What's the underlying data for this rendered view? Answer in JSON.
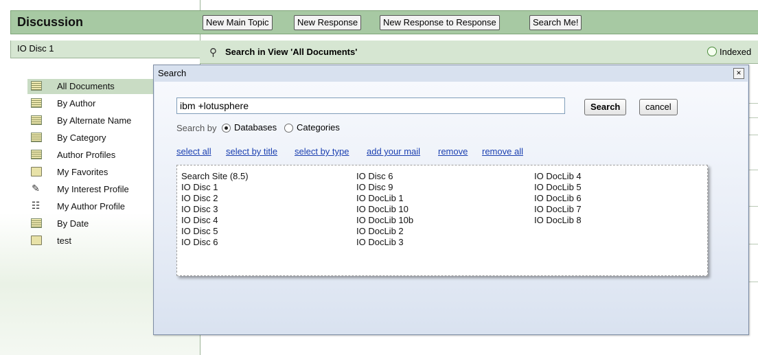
{
  "app": {
    "title": "Discussion",
    "db_name": "IO Disc 1"
  },
  "nav": {
    "items": [
      {
        "label": "All Documents",
        "icon": "view-icon",
        "selected": true
      },
      {
        "label": "By Author",
        "icon": "view-icon"
      },
      {
        "label": "By Alternate Name",
        "icon": "view-icon"
      },
      {
        "label": "By Category",
        "icon": "view-icon"
      },
      {
        "label": "Author Profiles",
        "icon": "view-icon"
      },
      {
        "label": "My Favorites",
        "icon": "folder-icon"
      },
      {
        "label": "My Interest Profile",
        "icon": "profile-icon"
      },
      {
        "label": "My Author Profile",
        "icon": "author-profile-icon"
      },
      {
        "label": "By Date",
        "icon": "view-icon"
      },
      {
        "label": "test",
        "icon": "folder-icon"
      }
    ]
  },
  "toolbar": {
    "new_main_topic": "New Main Topic",
    "new_response": "New Response",
    "new_response_to_response": "New Response to Response",
    "search_me": "Search Me!"
  },
  "view": {
    "search_title": "Search in View 'All Documents'",
    "indexed_label": "Indexed"
  },
  "dialog": {
    "title": "Search",
    "close_glyph": "×",
    "query": "ibm +lotusphere",
    "search_button": "Search",
    "cancel_button": "cancel",
    "search_by_label": "Search by",
    "radio_databases": "Databases",
    "radio_categories": "Categories",
    "selected_radio": "Databases",
    "links": {
      "select_all": "select all",
      "select_by_title": "select by title",
      "select_by_type": "select by type",
      "add_your_mail": "add your mail",
      "remove": "remove",
      "remove_all": "remove all"
    },
    "databases": {
      "col1": [
        "Search Site (8.5)",
        "IO Disc 1",
        "IO Disc 2",
        "IO Disc 3",
        "IO Disc 4",
        "IO Disc 5",
        "IO Disc 6"
      ],
      "col2": [
        "IO Disc 6",
        "IO Disc 9",
        "IO DocLib 1",
        "IO DocLib 10",
        "IO DocLib 10b",
        "IO DocLib 2",
        "IO DocLib 3"
      ],
      "col3": [
        "IO DocLib 4",
        "IO DocLib 5",
        "IO DocLib 6",
        "IO DocLib 7",
        "IO DocLib 8"
      ]
    }
  },
  "colors": {
    "header_green": "#a7c9a3",
    "subheader_green": "#d6e6d2",
    "link_blue": "#1a3fb0",
    "dialog_bg": "#d8e1ef"
  }
}
